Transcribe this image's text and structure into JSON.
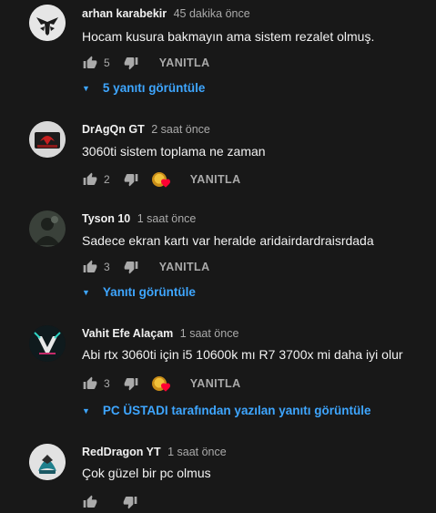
{
  "comments": [
    {
      "author": "arhan karabekir",
      "time": "45 dakika önce",
      "text": "Hocam kusura bakmayın ama sistem rezalet olmuş.",
      "likes": "5",
      "reply_label": "YANITLA",
      "view_replies": "5 yanıtı görüntüle",
      "avatar_icon": "eagle-logo-avatar"
    },
    {
      "author": "DrAgQn GT",
      "time": "2 saat önce",
      "text": "3060ti sistem toplama ne zaman",
      "likes": "2",
      "reply_label": "YANITLA",
      "avatar_icon": "dragon-logo-avatar",
      "creator_heart": true
    },
    {
      "author": "Tyson 10",
      "time": "1 saat önce",
      "text": "Sadece ekran kartı var heralde aridairdardraisrdada",
      "likes": "3",
      "reply_label": "YANITLA",
      "view_replies": "Yanıtı görüntüle",
      "avatar_icon": "dark-figure-avatar"
    },
    {
      "author": "Vahit Efe Alaçam",
      "time": "1 saat önce",
      "text": "Abi rtx 3060ti için i5 10600k mı R7 3700x mi daha iyi olur",
      "likes": "3",
      "reply_label": "YANITLA",
      "view_replies": "PC ÜSTADI tarafından yazılan yanıtı görüntüle",
      "avatar_icon": "vahit-logo-avatar",
      "creator_heart": true
    },
    {
      "author": "RedDragon YT",
      "time": "1 saat önce",
      "text": "Çok güzel bir pc olmus",
      "avatar_icon": "red-dragon-avatar"
    }
  ],
  "colors": {
    "background": "#181818",
    "link": "#3ea6ff",
    "muted": "#aaaaaa",
    "heart": "#ff0033"
  }
}
